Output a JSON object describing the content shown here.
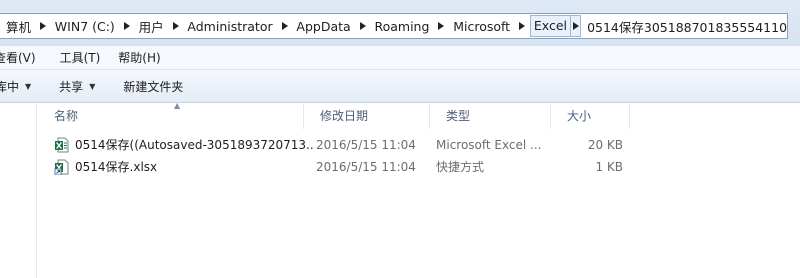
{
  "address": {
    "crumbs": [
      {
        "label": "算机"
      },
      {
        "label": "WIN7 (C:)"
      },
      {
        "label": "用户"
      },
      {
        "label": "Administrator"
      },
      {
        "label": "AppData"
      },
      {
        "label": "Roaming"
      },
      {
        "label": "Microsoft"
      },
      {
        "label": "Excel"
      }
    ],
    "tail": "0514保存305188701835554110"
  },
  "menubar": {
    "items": [
      {
        "label": "查看(V)"
      },
      {
        "label": "工具(T)"
      },
      {
        "label": "帮助(H)"
      }
    ]
  },
  "toolbar": {
    "library_label": "库中",
    "share_label": "共享",
    "new_folder_label": "新建文件夹"
  },
  "columns": {
    "name": "名称",
    "modified": "修改日期",
    "type": "类型",
    "size": "大小"
  },
  "files": [
    {
      "name": "0514保存((Autosaved-3051893720713...",
      "modified": "2016/5/15 11:04",
      "type": "Microsoft Excel ...",
      "size": "20 KB",
      "icon": "excel-file-icon"
    },
    {
      "name": "0514保存.xlsx",
      "modified": "2016/5/15 11:04",
      "type": "快捷方式",
      "size": "1 KB",
      "icon": "excel-shortcut-icon"
    }
  ],
  "colors": {
    "accent": "#1d7044",
    "header_text": "#4c607a"
  }
}
